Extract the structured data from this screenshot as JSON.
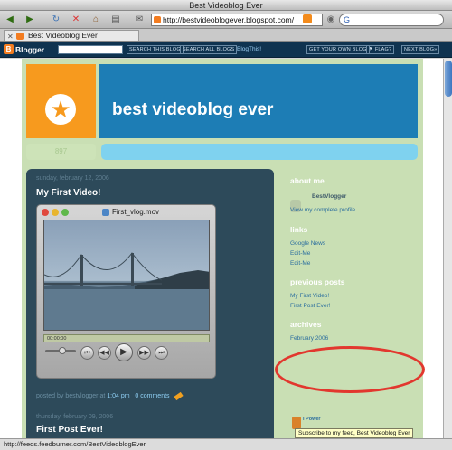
{
  "window": {
    "title": "Best Videoblog Ever"
  },
  "toolbar": {
    "url": "http://bestvideoblogever.blogspot.com/",
    "search_glyph": "G"
  },
  "tab": {
    "label": "Best Videoblog Ever"
  },
  "navbar": {
    "logo": "Blogger",
    "logo_glyph": "B",
    "search_this_blog": "SEARCH THIS BLOG",
    "search_all_blogs": "SEARCH ALL BLOGS",
    "blog_this": "BlogThis!",
    "get_own_blog": "GET YOUR OWN BLOG",
    "flag": "⚑ FLAG?",
    "next_blog": "NEXT BLOG»"
  },
  "blog": {
    "title": "best videoblog ever",
    "strip_text": "897",
    "posts": [
      {
        "date": "sunday, february 12, 2006",
        "title": "My First Video!",
        "footer_prefix": "posted by",
        "author": "bestvlogger",
        "at": "at",
        "time": "1:04 pm",
        "comments": "0 comments"
      },
      {
        "date": "thursday, february 09, 2006",
        "title": "First Post Ever!"
      }
    ]
  },
  "player": {
    "file": "First_vlog.mov",
    "timecode": "00:00:00"
  },
  "sidebar": {
    "about_heading": "about me",
    "profile_name": "BestVlogger",
    "profile_link": "View my complete profile",
    "links_heading": "links",
    "links": [
      "Google News",
      "Edit-Me",
      "Edit-Me"
    ],
    "previous_heading": "previous posts",
    "previous_posts": [
      "My First Video!",
      "First Post Ever!"
    ],
    "archives_heading": "archives",
    "archives": [
      "February 2006"
    ],
    "feed_power": "I Power",
    "tooltip": "Subscribe to my feed, Best Videoblog Ever"
  },
  "status": {
    "text": "http://feeds.feedburner.com/BestVideoblogEver"
  },
  "colors": {
    "header_blue": "#1d7db5",
    "header_orange": "#f79a1e",
    "main_column": "#2d4a5a",
    "sidebar_green": "#c9dfb4",
    "highlight_red": "#e2372e"
  }
}
